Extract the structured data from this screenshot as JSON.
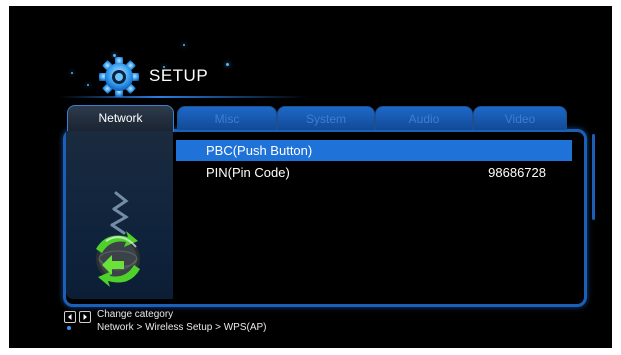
{
  "header": {
    "title": "SETUP",
    "icon": "gear-icon"
  },
  "tabs": [
    {
      "label": "Network",
      "active": true
    },
    {
      "label": "Misc",
      "active": false
    },
    {
      "label": "System",
      "active": false
    },
    {
      "label": "Audio",
      "active": false
    },
    {
      "label": "Video",
      "active": false
    }
  ],
  "menu": {
    "items": [
      {
        "label": "PBC(Push Button)",
        "value": "",
        "selected": true
      },
      {
        "label": "PIN(Pin Code)",
        "value": "98686728",
        "selected": false
      }
    ]
  },
  "footer": {
    "hint": "Change category",
    "breadcrumb": "Network > Wireless Setup > WPS(AP)"
  },
  "colors": {
    "accent": "#1f72d8",
    "panel_border": "#1a5fb8",
    "background": "#000000"
  }
}
